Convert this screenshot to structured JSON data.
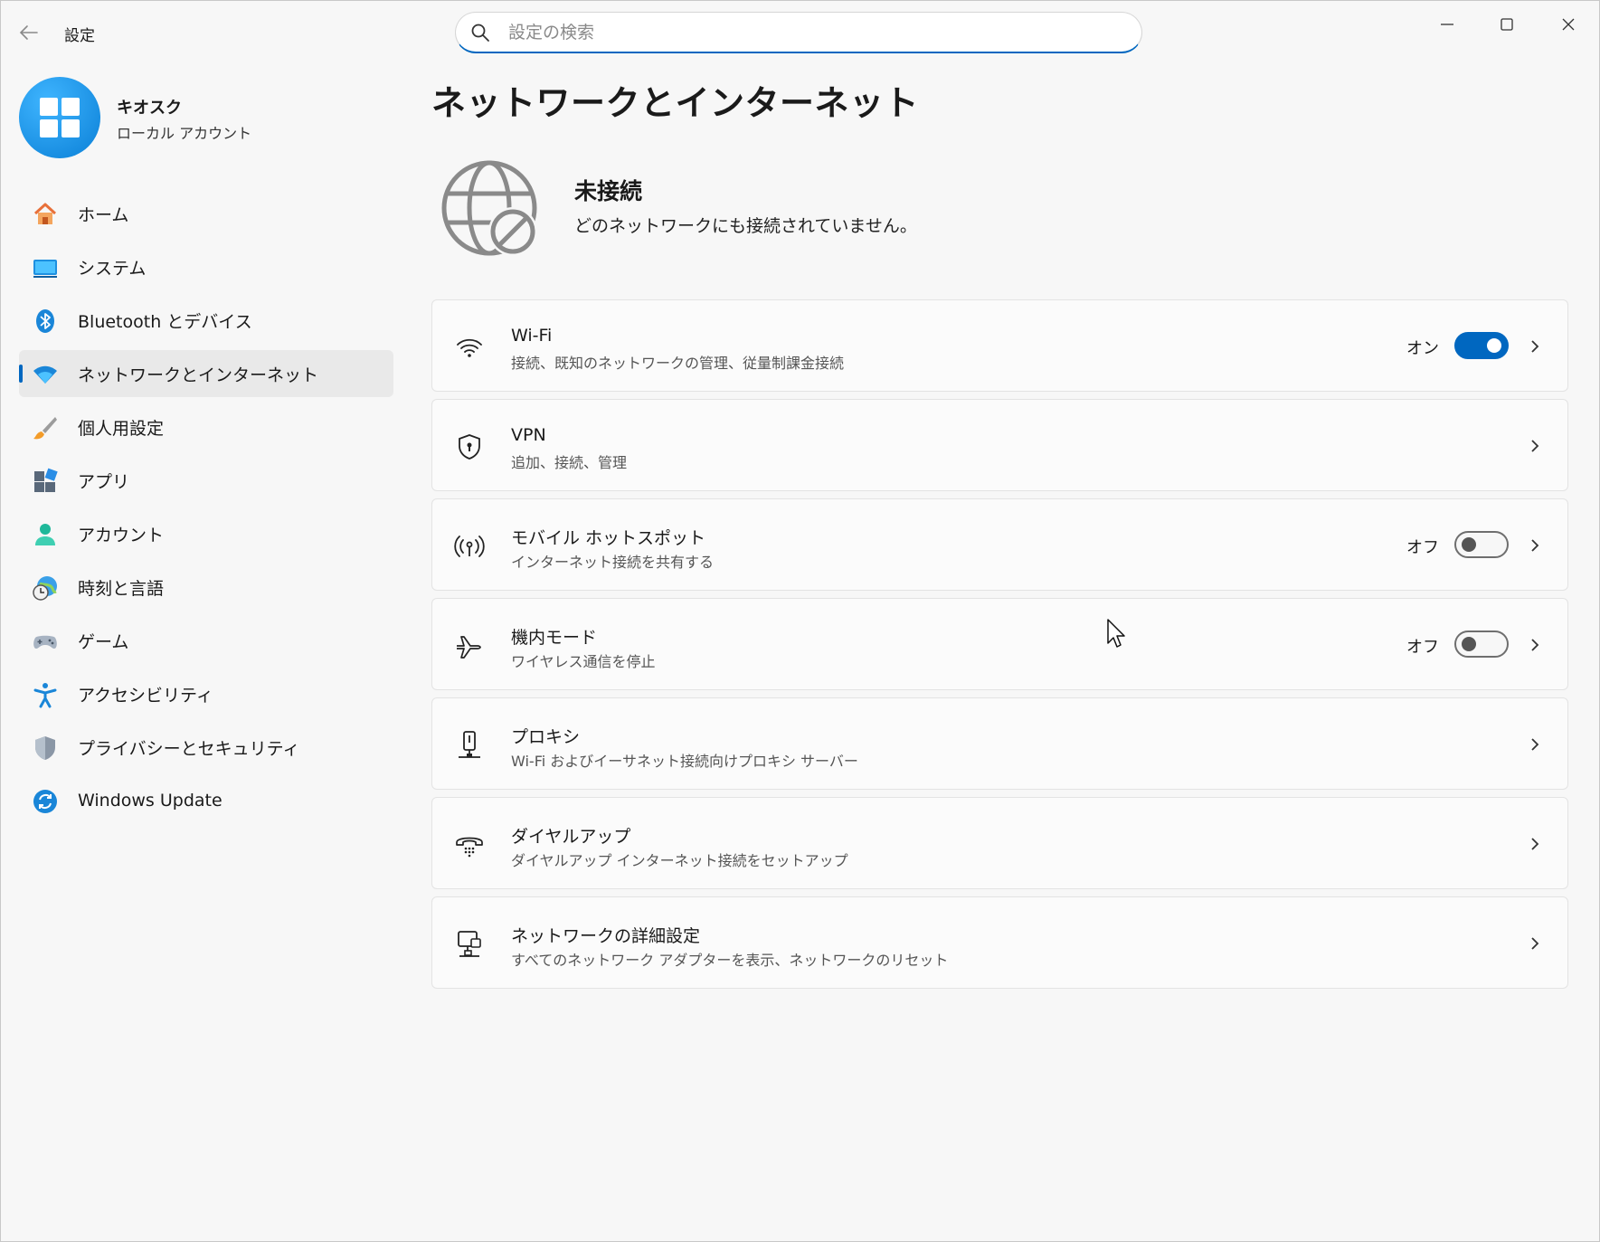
{
  "window": {
    "title": "設定",
    "search_placeholder": "設定の検索"
  },
  "profile": {
    "name": "キオスク",
    "account_type": "ローカル アカウント"
  },
  "sidebar": {
    "items": [
      {
        "label": "ホーム",
        "icon": "home-icon"
      },
      {
        "label": "システム",
        "icon": "system-icon"
      },
      {
        "label": "Bluetooth とデバイス",
        "icon": "bluetooth-icon"
      },
      {
        "label": "ネットワークとインターネット",
        "icon": "wifi-icon",
        "active": true
      },
      {
        "label": "個人用設定",
        "icon": "brush-icon"
      },
      {
        "label": "アプリ",
        "icon": "apps-icon"
      },
      {
        "label": "アカウント",
        "icon": "account-icon"
      },
      {
        "label": "時刻と言語",
        "icon": "time-language-icon"
      },
      {
        "label": "ゲーム",
        "icon": "gamepad-icon"
      },
      {
        "label": "アクセシビリティ",
        "icon": "accessibility-icon"
      },
      {
        "label": "プライバシーとセキュリティ",
        "icon": "shield-icon"
      },
      {
        "label": "Windows Update",
        "icon": "windows-update-icon"
      }
    ]
  },
  "main": {
    "title": "ネットワークとインターネット",
    "status": {
      "title": "未接続",
      "subtitle": "どのネットワークにも接続されていません。"
    },
    "cards": [
      {
        "title": "Wi-Fi",
        "subtitle": "接続、既知のネットワークの管理、従量制課金接続",
        "icon": "wifi-icon",
        "toggle_label": "オン",
        "toggle_on": true
      },
      {
        "title": "VPN",
        "subtitle": "追加、接続、管理",
        "icon": "vpn-shield-icon"
      },
      {
        "title": "モバイル ホットスポット",
        "subtitle": "インターネット接続を共有する",
        "icon": "hotspot-icon",
        "toggle_label": "オフ",
        "toggle_on": false
      },
      {
        "title": "機内モード",
        "subtitle": "ワイヤレス通信を停止",
        "icon": "airplane-icon",
        "toggle_label": "オフ",
        "toggle_on": false
      },
      {
        "title": "プロキシ",
        "subtitle": "Wi-Fi およびイーサネット接続向けプロキシ サーバー",
        "icon": "proxy-icon"
      },
      {
        "title": "ダイヤルアップ",
        "subtitle": "ダイヤルアップ インターネット接続をセットアップ",
        "icon": "dialup-icon"
      },
      {
        "title": "ネットワークの詳細設定",
        "subtitle": "すべてのネットワーク アダプターを表示、ネットワークのリセット",
        "icon": "network-advanced-icon"
      }
    ]
  },
  "colors": {
    "accent": "#0067c0",
    "window_bg": "#f7f7f7",
    "card_bg": "#fbfbfb"
  }
}
